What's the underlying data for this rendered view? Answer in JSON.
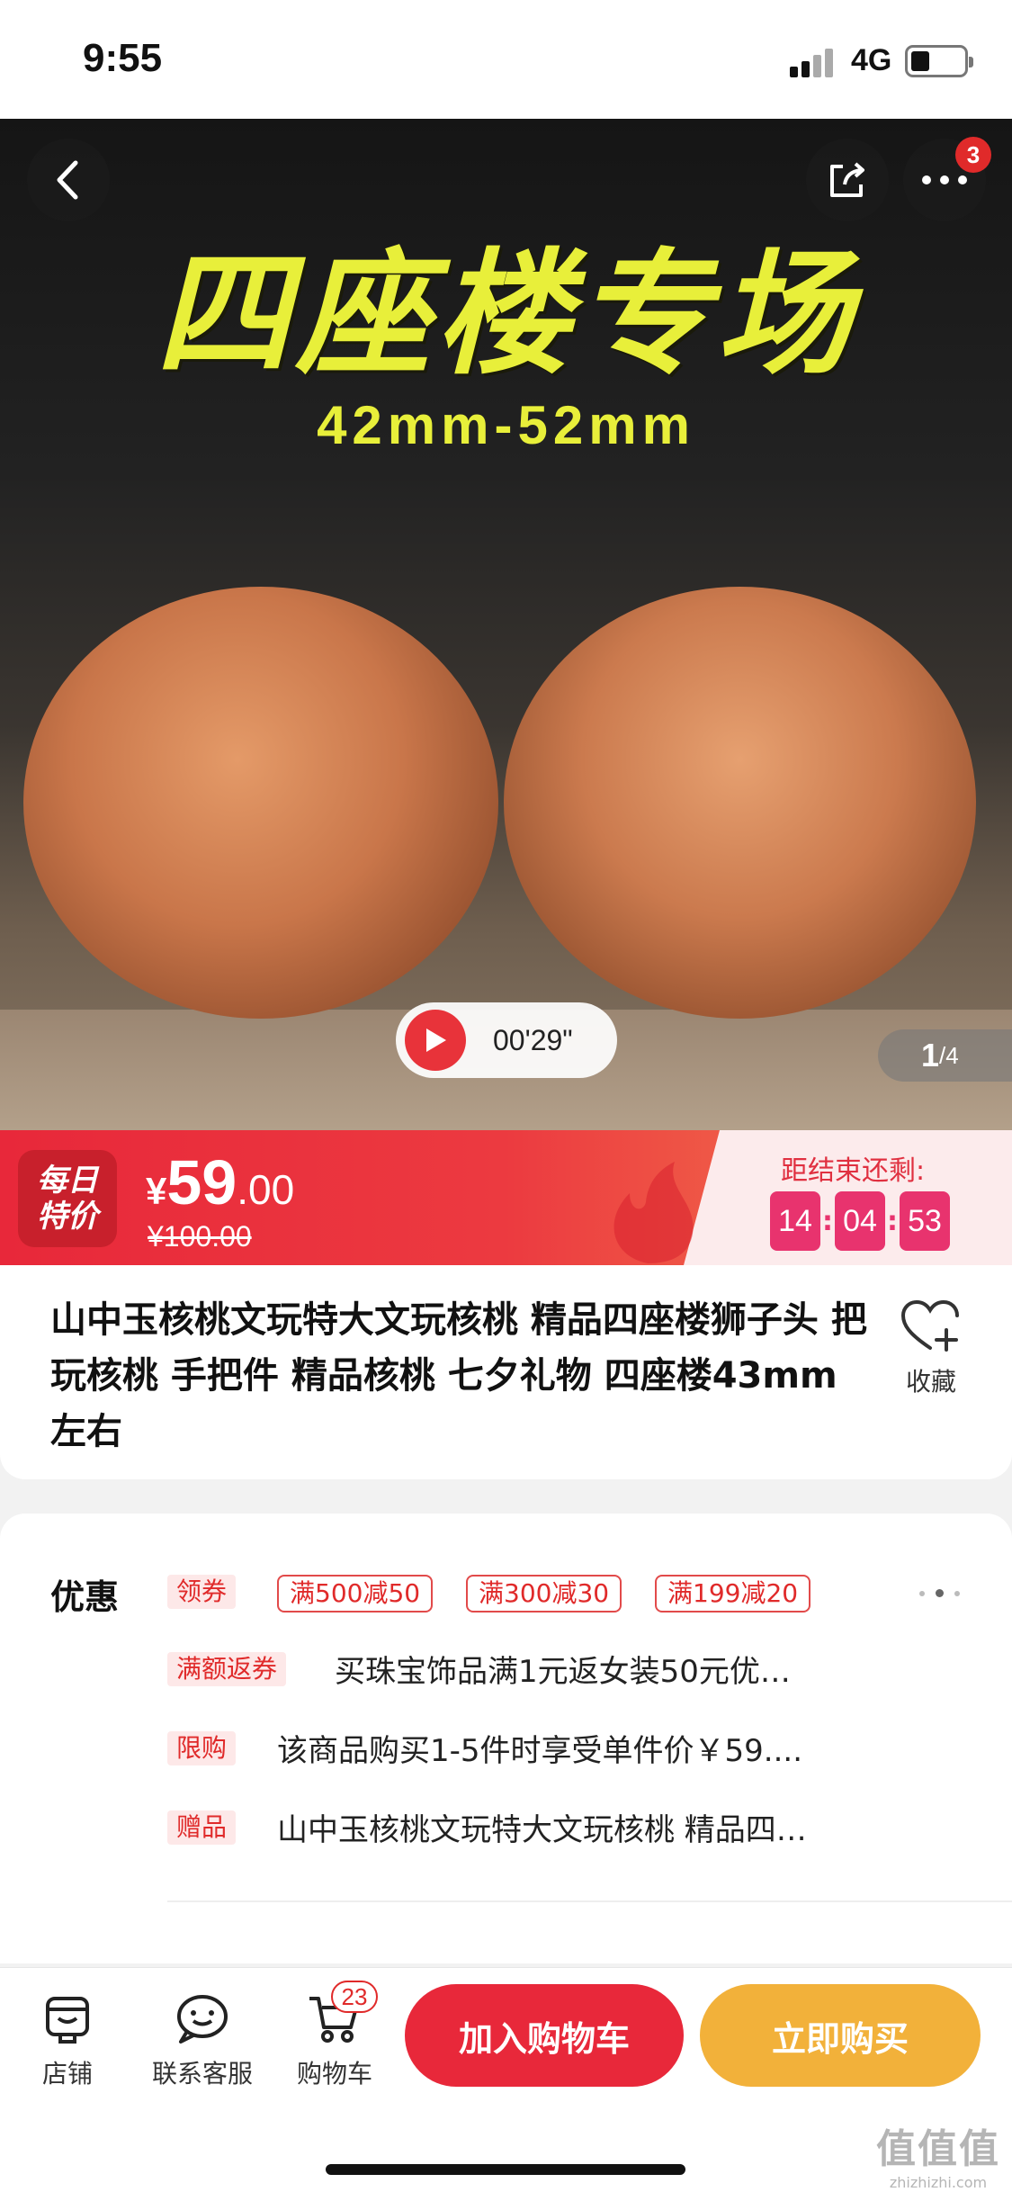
{
  "status": {
    "time": "9:55",
    "network": "4G"
  },
  "hero": {
    "headline": "四座楼专场",
    "size_text": "42mm-52mm",
    "more_badge": "3",
    "video_duration": "00'29\"",
    "page_current": "1",
    "page_total": "/4"
  },
  "price": {
    "badge_line1": "每日",
    "badge_line2": "特价",
    "currency": "¥",
    "integer": "59",
    "decimal": ".00",
    "original": "¥100.00",
    "countdown_label": "距结束还剩:",
    "hours": "14",
    "minutes": "04",
    "seconds": "53",
    "accent_color": "#e8283a"
  },
  "product": {
    "title": "山中玉核桃文玩特大文玩核桃 精品四座楼狮子头 把玩核桃 手把件 精品核桃 七夕礼物 四座楼43mm左右",
    "favorite_label": "收藏"
  },
  "promo": {
    "heading": "优惠",
    "coupon_tag": "领券",
    "coupons": [
      "满500减50",
      "满300减30",
      "满199减20"
    ],
    "rows": [
      {
        "tag": "满额返券",
        "text": "买珠宝饰品满1元返女装50元优…"
      },
      {
        "tag": "限购",
        "text": "该商品购买1-5件时享受单件价￥59...."
      },
      {
        "tag": "赠品",
        "text": "山中玉核桃文玩特大文玩核桃 精品四…"
      }
    ]
  },
  "bottom": {
    "store_label": "店铺",
    "service_label": "联系客服",
    "cart_label": "购物车",
    "cart_count": "23",
    "add_to_cart": "加入购物车",
    "buy_now": "立即购买",
    "buy_color": "#f2b13a"
  },
  "watermark": {
    "main": "值值值",
    "sub": "zhizhizhi.com"
  }
}
